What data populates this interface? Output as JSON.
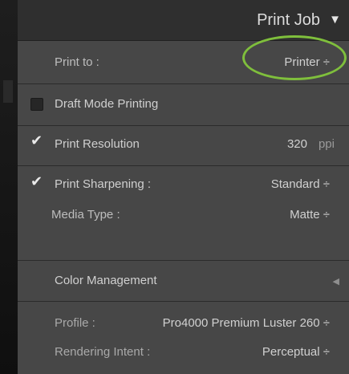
{
  "header": {
    "title": "Print Job",
    "collapse_icon": "▼"
  },
  "print_to": {
    "label": "Print to :",
    "value": "Printer ÷"
  },
  "draft_mode": {
    "label": "Draft Mode Printing",
    "checked": false
  },
  "print_resolution": {
    "label": "Print Resolution",
    "value": "320",
    "unit": "ppi",
    "checked": true
  },
  "print_sharpening": {
    "label": "Print Sharpening :",
    "value": "Standard ÷",
    "checked": true
  },
  "media_type": {
    "label": "Media Type :",
    "value": "Matte ÷"
  },
  "color_management": {
    "label": "Color Management",
    "expand_icon": "◀",
    "profile_label": "Profile :",
    "profile_value": "Pro4000 Premium Luster 260 ÷",
    "rendering_label": "Rendering Intent :",
    "rendering_value": "Perceptual ÷"
  },
  "colors": {
    "accent_ring": "#7fbf3c"
  }
}
